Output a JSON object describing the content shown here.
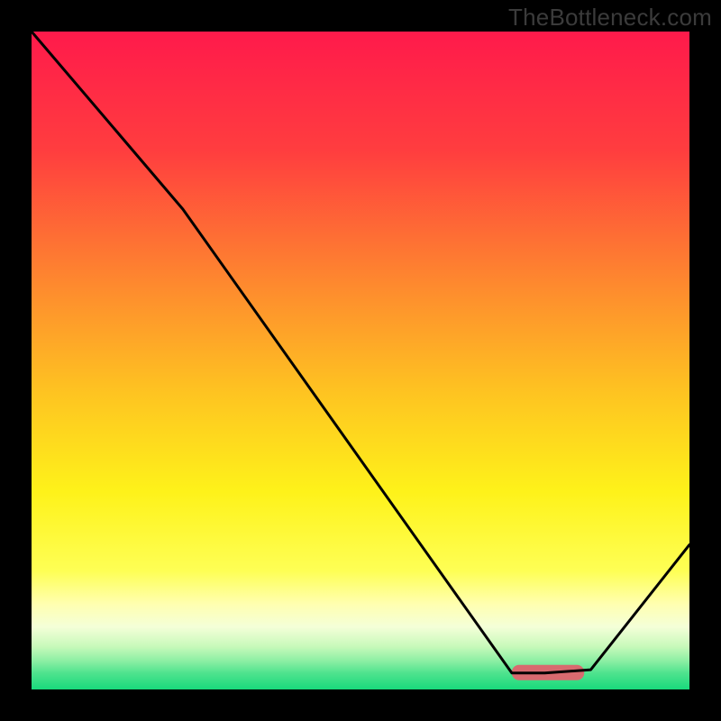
{
  "watermark": "TheBottleneck.com",
  "chart_data": {
    "type": "line",
    "title": "",
    "xlabel": "",
    "ylabel": "",
    "xlim": [
      0,
      100
    ],
    "ylim": [
      0,
      100
    ],
    "x": [
      0,
      23,
      73,
      78,
      85,
      100
    ],
    "values": [
      100,
      73,
      2.5,
      2.5,
      3,
      22
    ],
    "optimal_marker": {
      "x_start": 73,
      "x_end": 84,
      "y": 2.5
    },
    "gradient_stops": [
      {
        "offset": 0.0,
        "color": "#ff1a4b"
      },
      {
        "offset": 0.18,
        "color": "#ff3d3f"
      },
      {
        "offset": 0.4,
        "color": "#fe8f2d"
      },
      {
        "offset": 0.55,
        "color": "#fec421"
      },
      {
        "offset": 0.7,
        "color": "#fef21a"
      },
      {
        "offset": 0.82,
        "color": "#feff55"
      },
      {
        "offset": 0.87,
        "color": "#ffffb0"
      },
      {
        "offset": 0.905,
        "color": "#f4ffd8"
      },
      {
        "offset": 0.935,
        "color": "#c7f9ba"
      },
      {
        "offset": 0.958,
        "color": "#88eea2"
      },
      {
        "offset": 0.975,
        "color": "#4fe38e"
      },
      {
        "offset": 1.0,
        "color": "#18d97c"
      }
    ],
    "marker_color": "#d86a6f",
    "line_color": "#000000"
  }
}
